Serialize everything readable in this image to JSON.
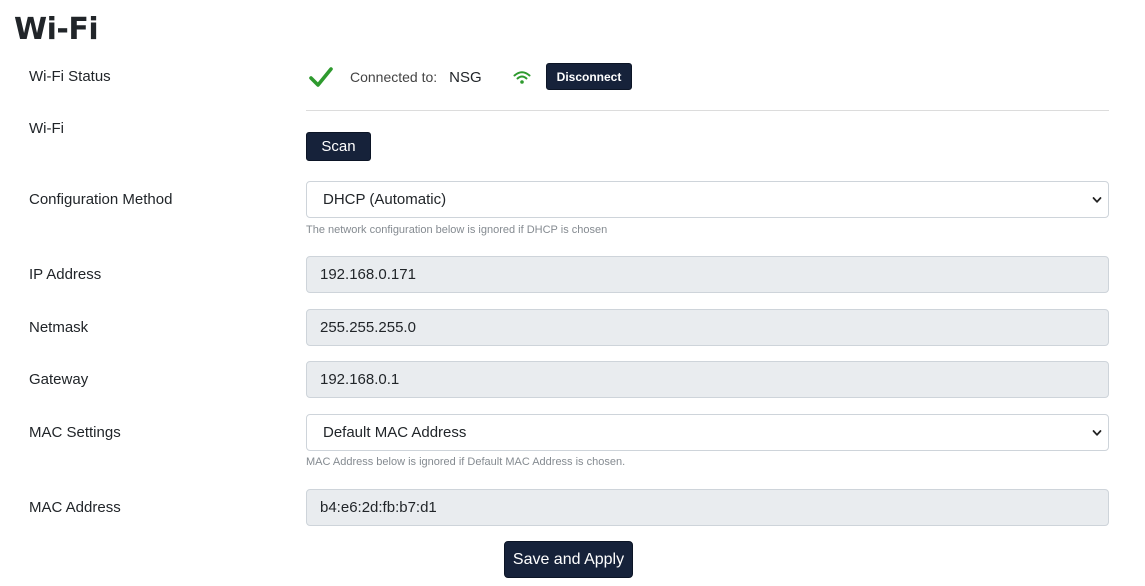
{
  "page": {
    "title": "Wi-Fi"
  },
  "status": {
    "label": "Wi-Fi Status",
    "connected_label": "Connected to:",
    "ssid": "NSG",
    "disconnect_label": "Disconnect"
  },
  "wifi": {
    "label": "Wi-Fi",
    "scan_label": "Scan"
  },
  "config_method": {
    "label": "Configuration Method",
    "selected": "DHCP (Automatic)",
    "help": "The network configuration below is ignored if DHCP is chosen"
  },
  "ip": {
    "label": "IP Address",
    "value": "192.168.0.171"
  },
  "netmask": {
    "label": "Netmask",
    "value": "255.255.255.0"
  },
  "gateway": {
    "label": "Gateway",
    "value": "192.168.0.1"
  },
  "mac_settings": {
    "label": "MAC Settings",
    "selected": "Default MAC Address",
    "help": "MAC Address below is ignored if Default MAC Address is chosen."
  },
  "mac_address": {
    "label": "MAC Address",
    "value": "b4:e6:2d:fb:b7:d1"
  },
  "actions": {
    "save_label": "Save and Apply"
  },
  "colors": {
    "accent_dark": "#16223a",
    "success_green": "#2e9a2e",
    "readonly_bg": "#e9ecef"
  },
  "icons": {
    "status": "check-icon",
    "signal": "wifi-signal-icon",
    "dropdown": "chevron-down-icon"
  }
}
